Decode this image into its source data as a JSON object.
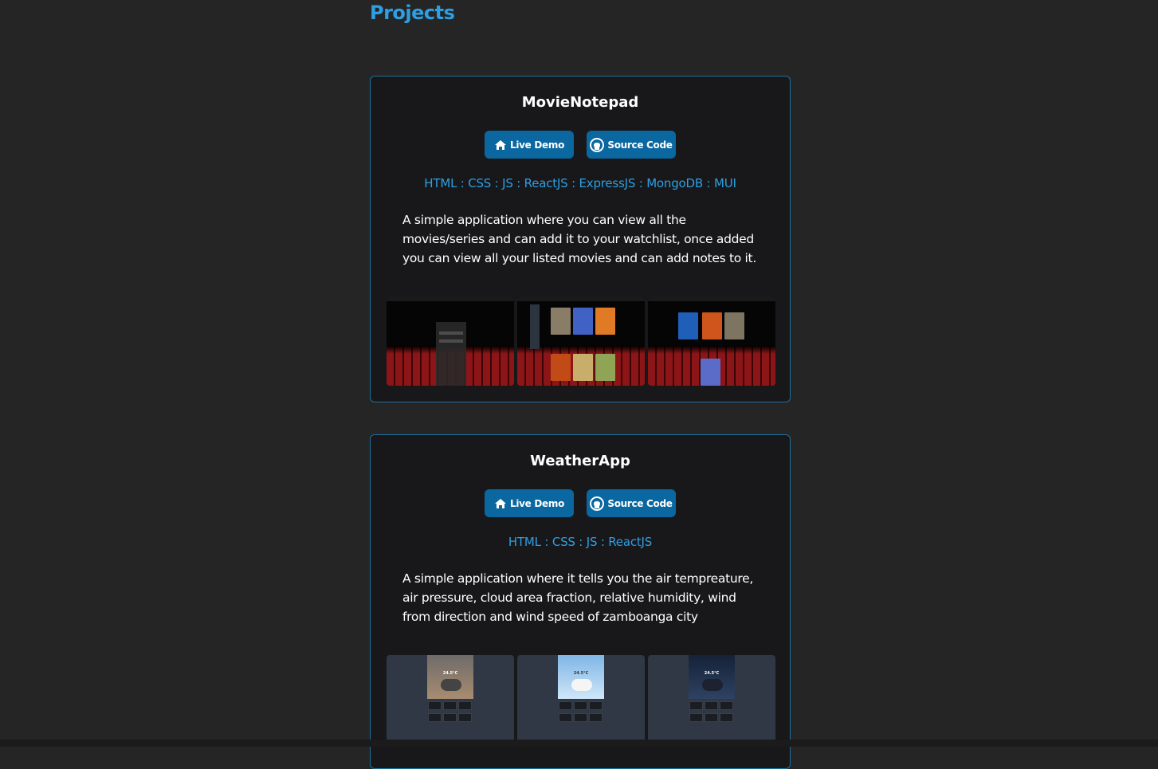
{
  "section": {
    "title": "Projects"
  },
  "projects": [
    {
      "name": "MovieNotepad",
      "live_demo_label": "Live Demo",
      "source_code_label": "Source Code",
      "tech": "HTML : CSS : JS : ReactJS : ExpressJS : MongoDB : MUI",
      "description": "A simple application where you can view all the movies/series and can add it to your watchlist, once added you can view all your listed movies and can add notes to it."
    },
    {
      "name": "WeatherApp",
      "live_demo_label": "Live Demo",
      "source_code_label": "Source Code",
      "tech": "HTML : CSS : JS : ReactJS",
      "description": "A simple application where it tells you the air tempreature, air pressure, cloud area fraction, relative humidity, wind from direction and wind speed of zamboanga city"
    }
  ],
  "weather_thumbs": [
    {
      "temp": "24.5°C"
    },
    {
      "temp": "24.5°C"
    },
    {
      "temp": "24.5°C"
    }
  ],
  "colors": {
    "accent": "#2d9fe3",
    "button": "#0a67a0",
    "card_bg": "#18181b",
    "card_border": "#1d6f9c",
    "page_bg": "#252525"
  },
  "icons": {
    "live_demo": "home-icon",
    "source_code": "github-icon"
  }
}
